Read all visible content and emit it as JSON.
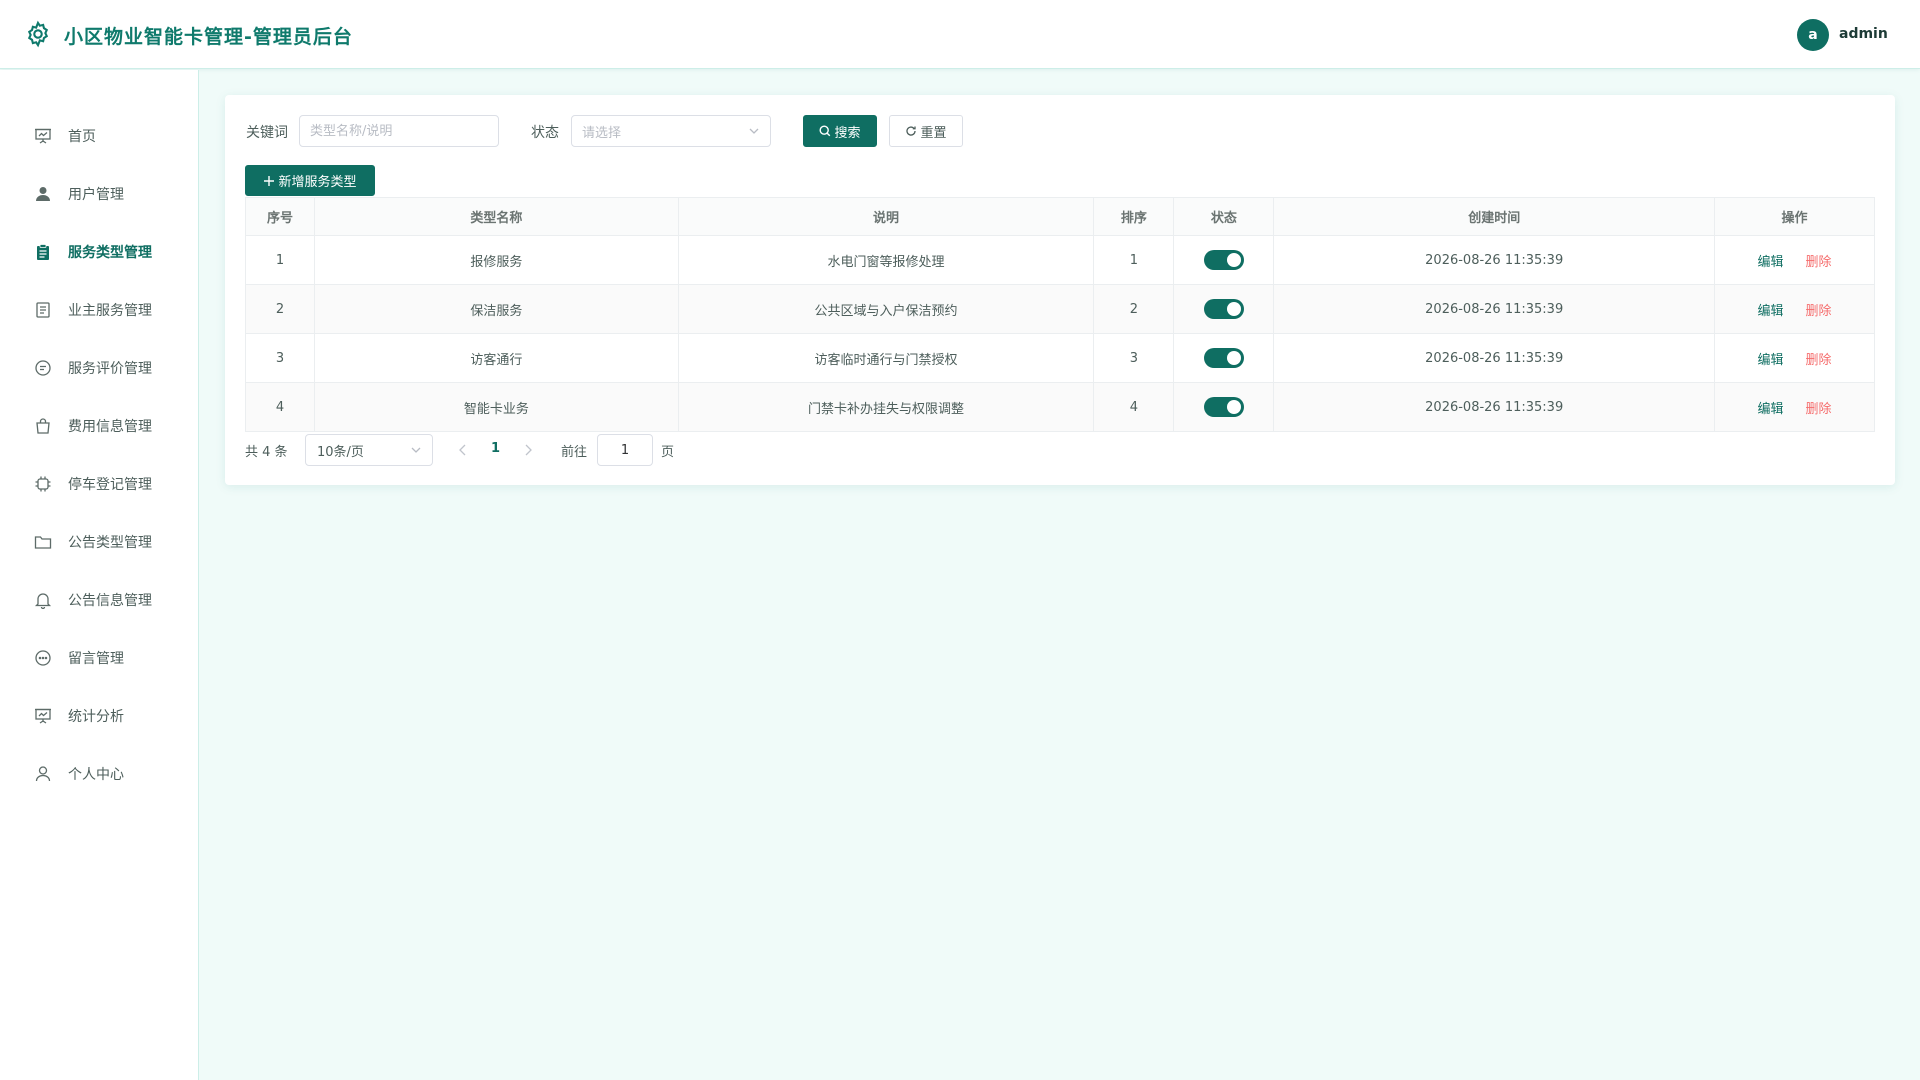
{
  "header": {
    "title": "小区物业智能卡管理-管理员后台",
    "avatar_letter": "a",
    "username": "admin",
    "accent_color": "#0f6e62"
  },
  "sidebar": {
    "items": [
      {
        "label": "首页",
        "icon": "presentation-board-icon",
        "active": false
      },
      {
        "label": "用户管理",
        "icon": "user-icon",
        "active": false
      },
      {
        "label": "服务类型管理",
        "icon": "clipboard-icon",
        "active": true
      },
      {
        "label": "业主服务管理",
        "icon": "document-list-icon",
        "active": false
      },
      {
        "label": "服务评价管理",
        "icon": "chat-bubble-icon",
        "active": false
      },
      {
        "label": "费用信息管理",
        "icon": "shopping-bag-icon",
        "active": false
      },
      {
        "label": "停车登记管理",
        "icon": "chip-icon",
        "active": false
      },
      {
        "label": "公告类型管理",
        "icon": "folder-icon",
        "active": false
      },
      {
        "label": "公告信息管理",
        "icon": "bell-icon",
        "active": false
      },
      {
        "label": "留言管理",
        "icon": "chat-dots-icon",
        "active": false
      },
      {
        "label": "统计分析",
        "icon": "presentation-board-icon",
        "active": false
      },
      {
        "label": "个人中心",
        "icon": "user-outline-icon",
        "active": false
      }
    ]
  },
  "filters": {
    "keyword_label": "关键词",
    "keyword_placeholder": "类型名称/说明",
    "status_label": "状态",
    "status_placeholder": "请选择",
    "search_label": "搜索",
    "reset_label": "重置"
  },
  "toolbar": {
    "add_label": "新增服务类型"
  },
  "table": {
    "columns": [
      "序号",
      "类型名称",
      "说明",
      "排序",
      "状态",
      "创建时间",
      "操作"
    ],
    "rows": [
      {
        "index": "1",
        "name": "报修服务",
        "desc": "水电门窗等报修处理",
        "sort": "1",
        "enabled": true,
        "created": "2026-08-26 11:35:39"
      },
      {
        "index": "2",
        "name": "保洁服务",
        "desc": "公共区域与入户保洁预约",
        "sort": "2",
        "enabled": true,
        "created": "2026-08-26 11:35:39"
      },
      {
        "index": "3",
        "name": "访客通行",
        "desc": "访客临时通行与门禁授权",
        "sort": "3",
        "enabled": true,
        "created": "2026-08-26 11:35:39"
      },
      {
        "index": "4",
        "name": "智能卡业务",
        "desc": "门禁卡补办挂失与权限调整",
        "sort": "4",
        "enabled": true,
        "created": "2026-08-26 11:35:39"
      }
    ],
    "edit_label": "编辑",
    "delete_label": "删除"
  },
  "pagination": {
    "total_text": "共 4 条",
    "page_size": "10条/页",
    "current_page": "1",
    "goto_label": "前往",
    "goto_value": "1",
    "page_unit": "页"
  }
}
